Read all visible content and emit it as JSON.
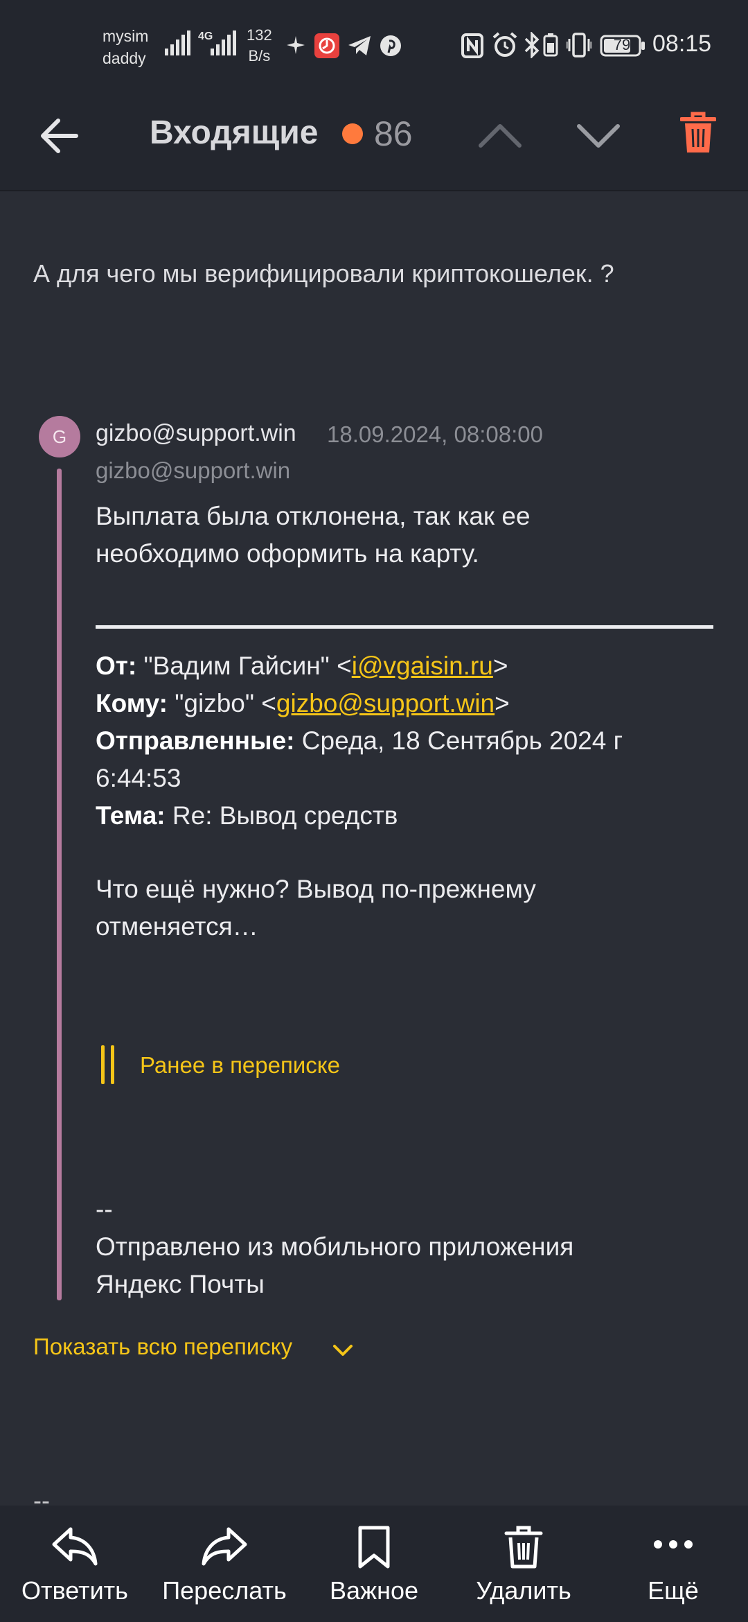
{
  "status_bar": {
    "carrier_line1": "mysim",
    "carrier_line2": "daddy",
    "net_speed_value": "132",
    "net_speed_unit": "B/s",
    "network_type": "4G",
    "battery_level": "79",
    "time": "08:15"
  },
  "toolbar": {
    "title": "Входящие",
    "unread_count": "86",
    "accent_color": "#ff7a3d"
  },
  "message": {
    "reply_text": "А для чего мы верифицировали криптокошелек. ?",
    "quoted": {
      "avatar_letter": "G",
      "sender": "gizbo@support.win",
      "date": "18.09.2024, 08:08:00",
      "sender_sub": "gizbo@support.win",
      "body_line1": "Выплата была отклонена, так как ее",
      "body_line2": "необходимо оформить на карту.",
      "headers": {
        "from_label": "От:",
        "from_name": "\"Вадим Гайсин\" <",
        "from_email": "i@vgaisin.ru",
        "from_close": ">",
        "to_label": "Кому:",
        "to_name": "\"gizbo\" <",
        "to_email": "gizbo@support.win",
        "to_close": ">",
        "sent_label": "Отправленные:",
        "sent_value_line1": "Среда, 18 Сентябрь 2024 г",
        "sent_value_line2": "6:44:53",
        "subject_label": "Тема:",
        "subject_value": "Re: Вывод средств"
      },
      "question_line1": "Что ещё нужно? Вывод по-прежнему",
      "question_line2": "отменяется…",
      "earlier_label": "Ранее в переписке",
      "signature_dashes": "--",
      "signature_line1": "Отправлено из мобильного приложения",
      "signature_line2": "Яндекс Почты"
    },
    "show_all_label": "Показать всю переписку",
    "trailing_dashes": "--"
  },
  "bottom_bar": {
    "reply": "Ответить",
    "forward": "Переслать",
    "important": "Важное",
    "delete": "Удалить",
    "more": "Ещё"
  },
  "colors": {
    "background": "#2a2d35",
    "bar_background": "#23262e",
    "link": "#f5c518",
    "quote_bar": "#b57b9e",
    "delete_icon": "#ff6b4a"
  }
}
